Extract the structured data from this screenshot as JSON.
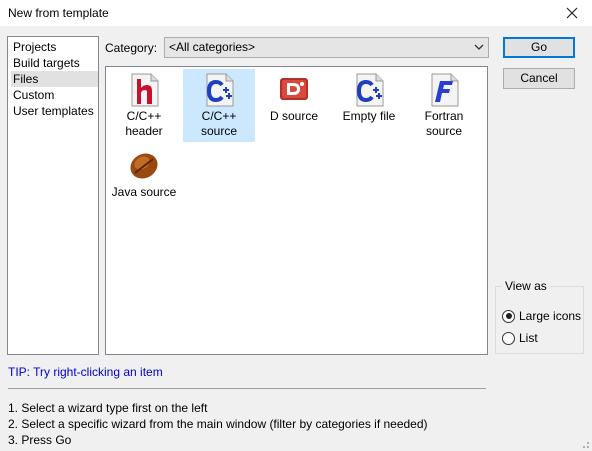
{
  "window": {
    "title": "New from template",
    "close_icon": "close-icon"
  },
  "left_list": {
    "items": [
      {
        "label": "Projects",
        "selected": false
      },
      {
        "label": "Build targets",
        "selected": false
      },
      {
        "label": "Files",
        "selected": true
      },
      {
        "label": "Custom",
        "selected": false
      },
      {
        "label": "User templates",
        "selected": false
      }
    ]
  },
  "category": {
    "label": "Category:",
    "value": "<All categories>"
  },
  "templates": [
    {
      "line1": "C/C++",
      "line2": "header",
      "icon": "cpp-header-icon",
      "selected": false
    },
    {
      "line1": "C/C++",
      "line2": "source",
      "icon": "cpp-source-icon",
      "selected": true
    },
    {
      "line1": "D source",
      "line2": "",
      "icon": "d-source-icon",
      "selected": false
    },
    {
      "line1": "Empty file",
      "line2": "",
      "icon": "empty-file-icon",
      "selected": false
    },
    {
      "line1": "Fortran",
      "line2": "source",
      "icon": "fortran-source-icon",
      "selected": false
    },
    {
      "line1": "Java source",
      "line2": "",
      "icon": "java-source-icon",
      "selected": false
    }
  ],
  "buttons": {
    "go": "Go",
    "cancel": "Cancel"
  },
  "view_as": {
    "legend": "View as",
    "options": [
      {
        "label": "Large icons",
        "checked": true
      },
      {
        "label": "List",
        "checked": false
      }
    ]
  },
  "tip": "TIP: Try right-clicking an item",
  "instructions": [
    "1. Select a wizard type first on the left",
    "2. Select a specific wizard from the main window (filter by categories if needed)",
    "3. Press Go"
  ],
  "colors": {
    "selection": "#cce8ff",
    "tip": "#0000cc",
    "default_button_border": "#0078d7"
  }
}
